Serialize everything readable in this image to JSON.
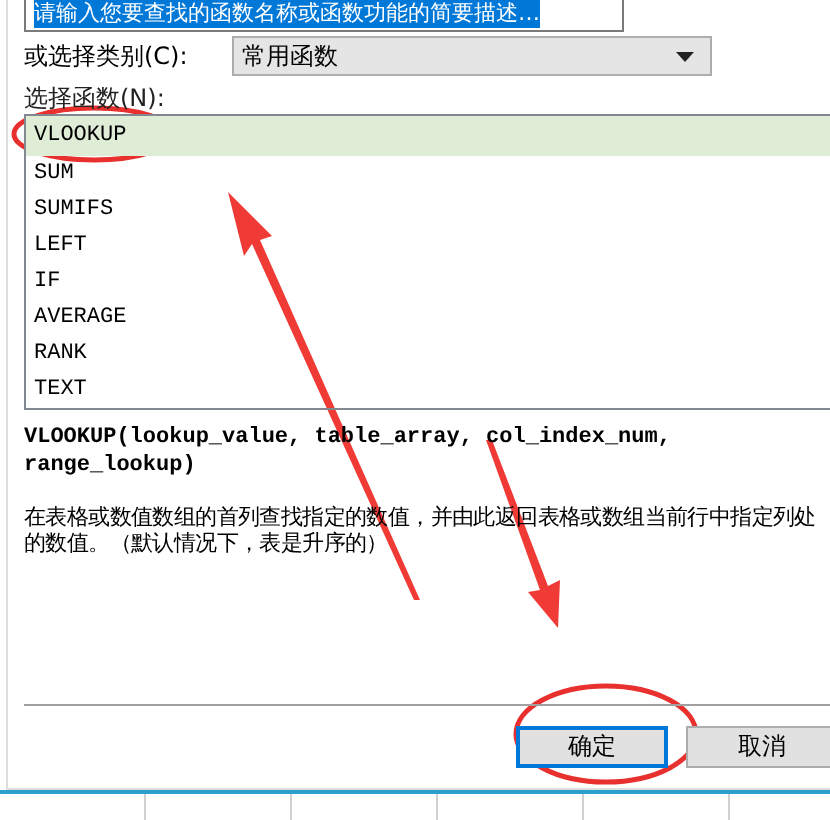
{
  "search": {
    "value": "请输入您要查找的函数名称或函数功能的简要描述…",
    "highlighted": true
  },
  "category": {
    "label": "或选择类别(C):",
    "value": "常用函数"
  },
  "function_list": {
    "label": "选择函数(N):",
    "items": [
      {
        "label": "VLOOKUP",
        "selected": true
      },
      {
        "label": "SUM",
        "selected": false
      },
      {
        "label": "SUMIFS",
        "selected": false
      },
      {
        "label": "LEFT",
        "selected": false
      },
      {
        "label": "IF",
        "selected": false
      },
      {
        "label": "AVERAGE",
        "selected": false
      },
      {
        "label": "RANK",
        "selected": false
      },
      {
        "label": "TEXT",
        "selected": false
      }
    ]
  },
  "signature": "VLOOKUP(lookup_value, table_array, col_index_num, range_lookup)",
  "description": "在表格或数值数组的首列查找指定的数值，并由此返回表格或数组当前行中指定列处的数值。（默认情况下，表是升序的）",
  "buttons": [
    {
      "label": "确定",
      "default": true
    },
    {
      "label": "取消",
      "default": false
    }
  ]
}
